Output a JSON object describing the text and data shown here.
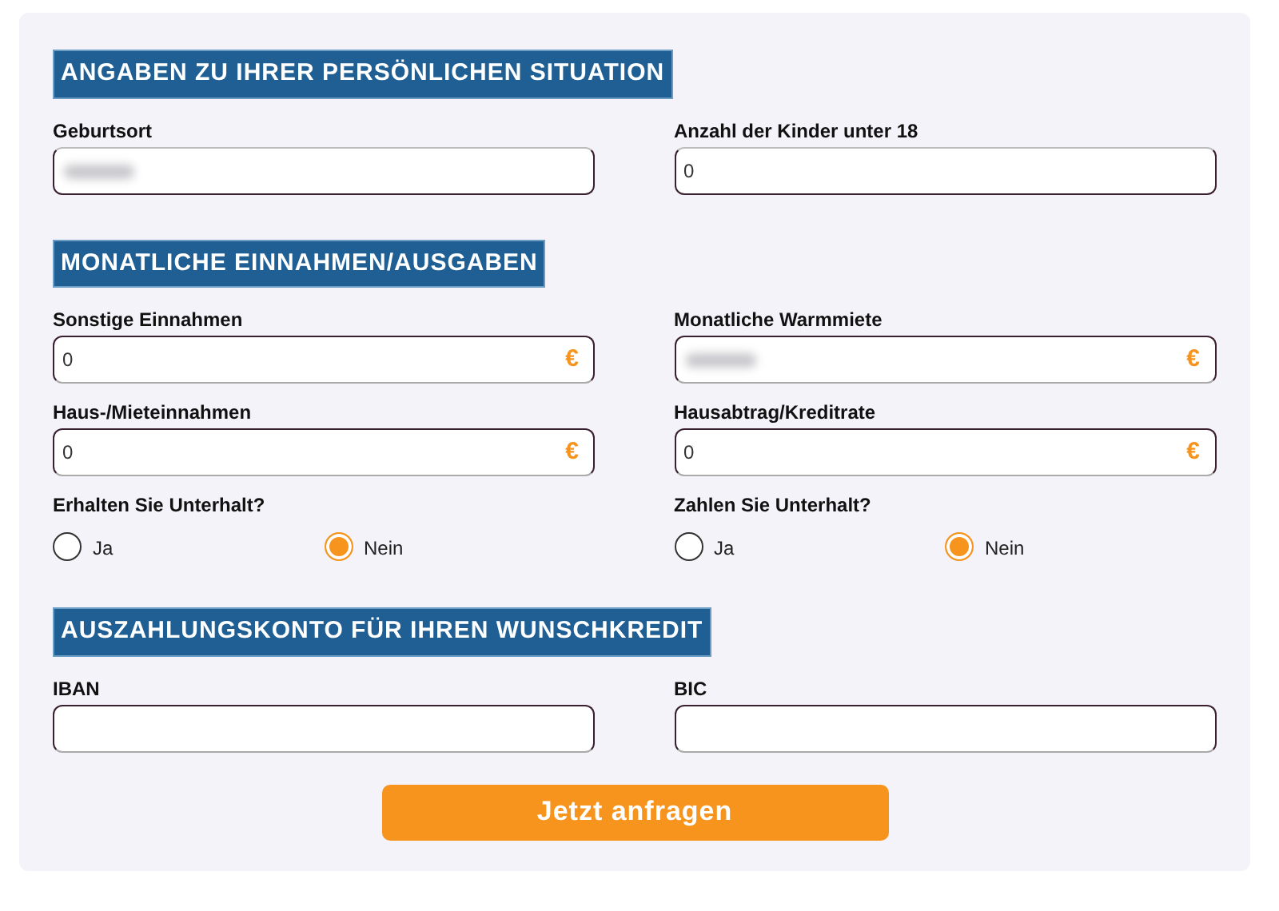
{
  "sections": [
    {
      "heading": "ANGABEN ZU IHRER PERSÖNLICHEN SITUATION",
      "rows": [
        {
          "kind": "fields",
          "items": [
            {
              "label": "Geburtsort",
              "redacted": true
            },
            {
              "label": "Anzahl der Kinder unter 18",
              "value": "0",
              "redacted": false
            }
          ]
        }
      ]
    },
    {
      "heading": "MONATLICHE EINNAHMEN/AUSGABEN",
      "rows": [
        {
          "kind": "fields",
          "items": [
            {
              "label": "Sonstige Einnahmen",
              "value": "0",
              "redacted": false,
              "symbol": "€"
            },
            {
              "label": "Monatliche Warmmiete",
              "redacted": true,
              "symbol": "€"
            }
          ]
        },
        {
          "kind": "fields",
          "items": [
            {
              "label": "Haus-/Mieteinnahmen",
              "value": "0",
              "redacted": false,
              "symbol": "€"
            },
            {
              "label": "Hausabtrag/Kreditrate",
              "value": "0",
              "redacted": false,
              "symbol": "€"
            }
          ]
        },
        {
          "kind": "radios",
          "items": [
            {
              "label": "Erhalten Sie Unterhalt?",
              "options": [
                {
                  "label": "Ja",
                  "selected": false
                },
                {
                  "label": "Nein",
                  "selected": true
                }
              ]
            },
            {
              "label": "Zahlen Sie Unterhalt?",
              "options": [
                {
                  "label": "Ja",
                  "selected": false
                },
                {
                  "label": "Nein",
                  "selected": true
                }
              ]
            }
          ]
        }
      ]
    },
    {
      "heading": "AUSZAHLUNGSKONTO FÜR IHREN WUNSCHKREDIT",
      "rows": [
        {
          "kind": "fields",
          "items": [
            {
              "label": "IBAN",
              "redacted": false
            },
            {
              "label": "BIC",
              "redacted": false
            }
          ]
        }
      ]
    }
  ],
  "submit": "Jetzt anfragen"
}
